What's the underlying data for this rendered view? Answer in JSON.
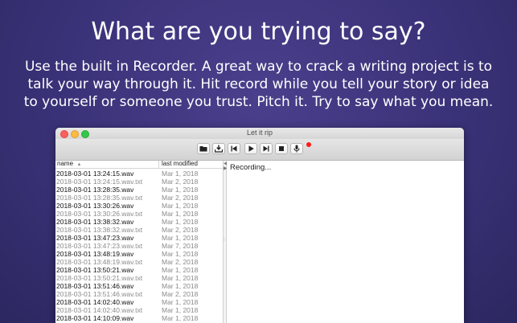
{
  "promo": {
    "headline": "What are you trying to say?",
    "line1": "Use the built in Recorder.  A great way to crack a writing project is to",
    "line2": "talk your way through it.  Hit record while you tell your story or idea",
    "line3": "to yourself or someone you trust.  Pitch it.  Try to say what you mean."
  },
  "window": {
    "title": "Let it rip"
  },
  "toolbar": {
    "buttons": [
      {
        "id": "open",
        "icon": "folder-icon"
      },
      {
        "id": "download",
        "icon": "download-tray-icon"
      },
      {
        "id": "skip-back",
        "icon": "skip-back-icon"
      },
      {
        "id": "play",
        "icon": "play-icon"
      },
      {
        "id": "skip-forward",
        "icon": "skip-forward-icon"
      },
      {
        "id": "stop",
        "icon": "stop-icon"
      },
      {
        "id": "record",
        "icon": "microphone-icon"
      }
    ],
    "recording_indicator_color": "#ff1a1a"
  },
  "file_list": {
    "columns": [
      "name",
      "last modified"
    ],
    "sort_indicator": "▲",
    "rows": [
      {
        "name": "2018-03-01 13:24:15.wav",
        "modified": "Mar 1, 2018",
        "kind": "wav"
      },
      {
        "name": "2018-03-01 13:24:15.wav.txt",
        "modified": "Mar 2, 2018",
        "kind": "txt"
      },
      {
        "name": "2018-03-01 13:28:35.wav",
        "modified": "Mar 1, 2018",
        "kind": "wav"
      },
      {
        "name": "2018-03-01 13:28:35.wav.txt",
        "modified": "Mar 2, 2018",
        "kind": "txt"
      },
      {
        "name": "2018-03-01 13:30:26.wav",
        "modified": "Mar 1, 2018",
        "kind": "wav"
      },
      {
        "name": "2018-03-01 13:30:26.wav.txt",
        "modified": "Mar 1, 2018",
        "kind": "txt"
      },
      {
        "name": "2018-03-01 13:38:32.wav",
        "modified": "Mar 1, 2018",
        "kind": "wav"
      },
      {
        "name": "2018-03-01 13:38:32.wav.txt",
        "modified": "Mar 2, 2018",
        "kind": "txt"
      },
      {
        "name": "2018-03-01 13:47:23.wav",
        "modified": "Mar 1, 2018",
        "kind": "wav"
      },
      {
        "name": "2018-03-01 13:47:23.wav.txt",
        "modified": "Mar 7, 2018",
        "kind": "txt"
      },
      {
        "name": "2018-03-01 13:48:19.wav",
        "modified": "Mar 1, 2018",
        "kind": "wav"
      },
      {
        "name": "2018-03-01 13:48:19.wav.txt",
        "modified": "Mar 2, 2018",
        "kind": "txt"
      },
      {
        "name": "2018-03-01 13:50:21.wav",
        "modified": "Mar 1, 2018",
        "kind": "wav"
      },
      {
        "name": "2018-03-01 13:50:21.wav.txt",
        "modified": "Mar 1, 2018",
        "kind": "txt"
      },
      {
        "name": "2018-03-01 13:51:46.wav",
        "modified": "Mar 1, 2018",
        "kind": "wav"
      },
      {
        "name": "2018-03-01 13:51:46.wav.txt",
        "modified": "Mar 2, 2018",
        "kind": "txt"
      },
      {
        "name": "2018-03-01 14:02:40.wav",
        "modified": "Mar 1, 2018",
        "kind": "wav"
      },
      {
        "name": "2018-03-01 14:02:40.wav.txt",
        "modified": "Mar 1, 2018",
        "kind": "txt"
      },
      {
        "name": "2018-03-01 14:10:09.wav",
        "modified": "Mar 1, 2018",
        "kind": "wav"
      }
    ]
  },
  "editor": {
    "text": "Recording..."
  }
}
